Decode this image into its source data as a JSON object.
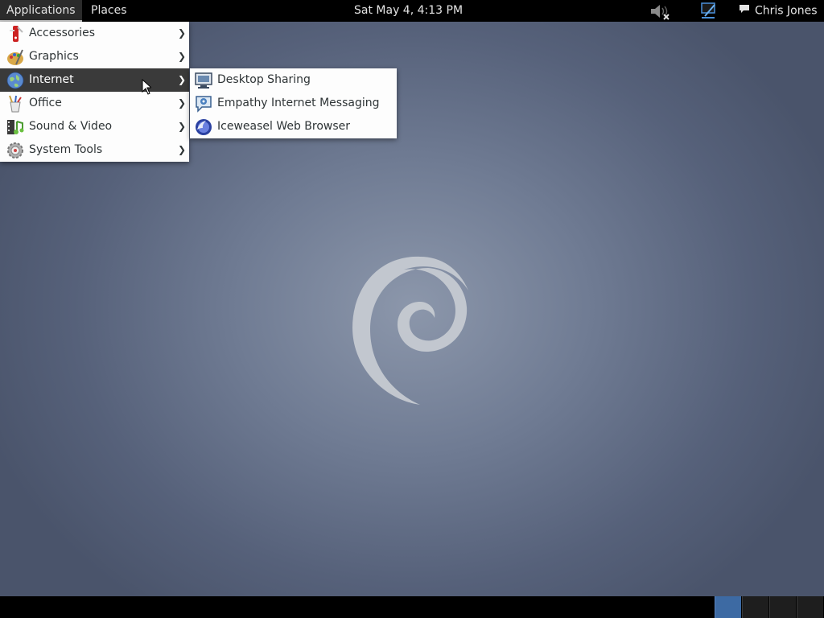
{
  "topbar": {
    "applications_label": "Applications",
    "places_label": "Places",
    "clock": "Sat May  4,  4:13 PM",
    "user_name": "Chris Jones"
  },
  "applications_menu": {
    "items": [
      {
        "label": "Accessories",
        "icon": "accessories-icon"
      },
      {
        "label": "Graphics",
        "icon": "graphics-icon"
      },
      {
        "label": "Internet",
        "icon": "internet-icon",
        "active": true
      },
      {
        "label": "Office",
        "icon": "office-icon"
      },
      {
        "label": "Sound & Video",
        "icon": "sound-video-icon"
      },
      {
        "label": "System Tools",
        "icon": "system-tools-icon"
      }
    ]
  },
  "internet_submenu": {
    "items": [
      {
        "label": "Desktop Sharing",
        "icon": "desktop-sharing-icon"
      },
      {
        "label": "Empathy Internet Messaging",
        "icon": "empathy-icon"
      },
      {
        "label": "Iceweasel Web Browser",
        "icon": "iceweasel-icon"
      }
    ]
  },
  "workspaces": {
    "count": 4,
    "current": 1
  },
  "colors": {
    "accent": "#3d6aa3",
    "topbar": "#000000",
    "menu_active": "#3a3a3a"
  }
}
